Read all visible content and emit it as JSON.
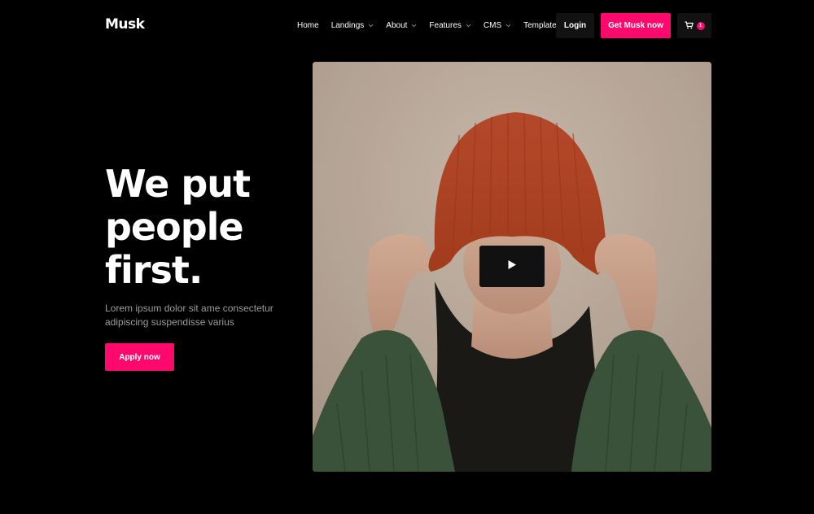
{
  "header": {
    "logo": "Musk",
    "nav": [
      {
        "label": "Home",
        "has_dropdown": false
      },
      {
        "label": "Landings",
        "has_dropdown": true
      },
      {
        "label": "About",
        "has_dropdown": true
      },
      {
        "label": "Features",
        "has_dropdown": true
      },
      {
        "label": "CMS",
        "has_dropdown": true
      },
      {
        "label": "Template",
        "has_dropdown": true
      }
    ],
    "login_label": "Login",
    "cta_label": "Get Musk now",
    "cart_count": "1",
    "cart_icon": "cart-icon"
  },
  "hero": {
    "title": "We put\npeople\nfirst.",
    "description": "Lorem ipsum dolor sit ame consectetur adipiscing suspendisse varius",
    "apply_label": "Apply now"
  },
  "media": {
    "play_icon": "play-icon",
    "subject": "person pulling orange beanie over eyes, green knit sweater"
  },
  "colors": {
    "background": "#000000",
    "accent": "#ff0a6c",
    "muted_text": "#9a9a9a",
    "button_dark": "#121212"
  }
}
